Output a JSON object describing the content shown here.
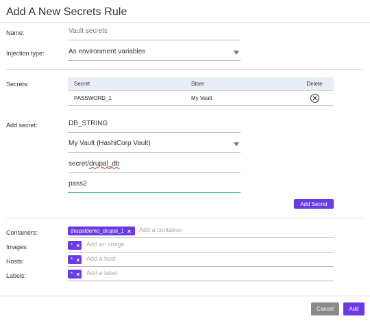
{
  "dialog": {
    "title": "Add A New Secrets Rule"
  },
  "form": {
    "name_label": "Name:",
    "name_value": "Vault secrets",
    "injection_label": "Injection type:",
    "injection_value": "As environment variables"
  },
  "secrets_table": {
    "label": "Secrets:",
    "headers": {
      "secret": "Secret",
      "store": "Store",
      "delete": "Delete"
    },
    "rows": [
      {
        "secret": "PASSWORD_1",
        "store": "My Vault"
      }
    ]
  },
  "add_secret": {
    "label": "Add secret:",
    "name_value": "DB_STRING",
    "store_value": "My Vault (HashiCorp Vault)",
    "path_prefix": "secret/",
    "path_suffix": "drupal_db",
    "key_value": "pass2",
    "button_label": "Add Secret"
  },
  "scope": {
    "containers_label": "Containers:",
    "containers_chip": "drupaldemo_drupal_1",
    "containers_placeholder": "Add a container",
    "images_label": "Images:",
    "images_chip": "*",
    "images_placeholder": "Add an image",
    "hosts_label": "Hosts:",
    "hosts_chip": "*",
    "hosts_placeholder": "Add a host",
    "labels_label": "Labels:",
    "labels_chip": "*",
    "labels_placeholder": "Add a label",
    "chip_remove_glyph": "×"
  },
  "footer": {
    "cancel_label": "Cancel",
    "add_label": "Add"
  },
  "colors": {
    "accent": "#6a3be4",
    "focus_underline": "#3fb28c",
    "table_header_bg": "#e8edf6",
    "cancel_bg": "#8a8a8a"
  }
}
